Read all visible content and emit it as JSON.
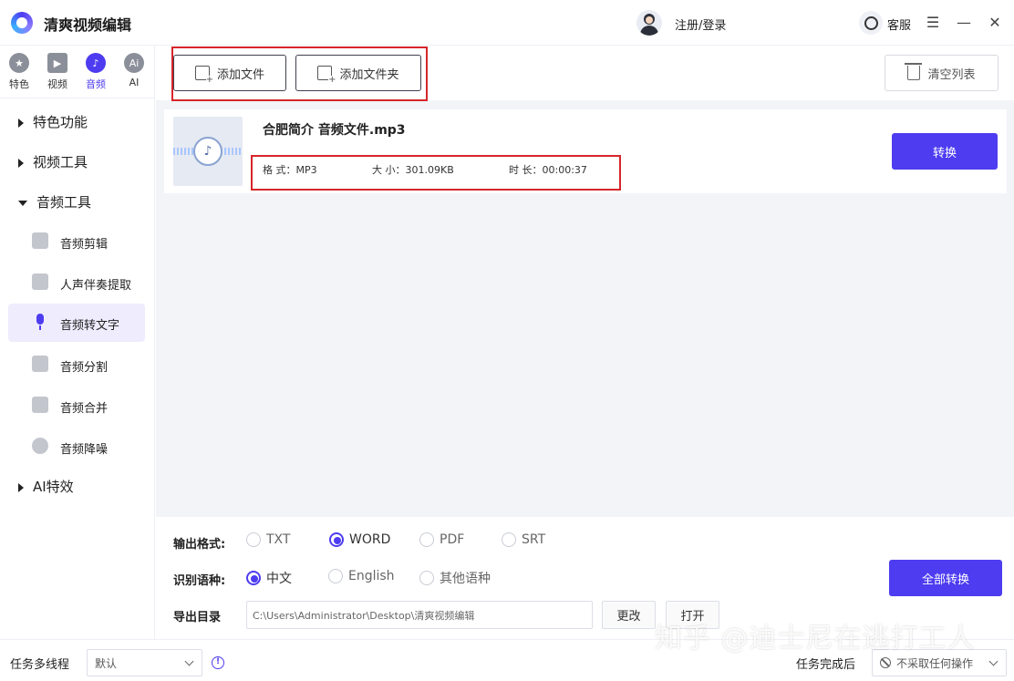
{
  "app": {
    "title": "清爽视频编辑",
    "login": "注册/登录",
    "service": "客服",
    "window_min": "—",
    "window_close": "✕",
    "window_menu": "☰"
  },
  "categories": [
    {
      "label": "特色",
      "glyph": "★"
    },
    {
      "label": "视频",
      "glyph": "▶"
    },
    {
      "label": "音频",
      "glyph": "♪"
    },
    {
      "label": "AI",
      "glyph": "Ai"
    }
  ],
  "sidebar": {
    "sections": [
      {
        "label": "特色功能"
      },
      {
        "label": "视频工具"
      },
      {
        "label": "音频工具"
      },
      {
        "label": "AI特效"
      }
    ],
    "items": [
      {
        "label": "音频剪辑"
      },
      {
        "label": "人声伴奏提取"
      },
      {
        "label": "音频转文字"
      },
      {
        "label": "音频分割"
      },
      {
        "label": "音频合并"
      },
      {
        "label": "音频降噪"
      }
    ]
  },
  "toolbar": {
    "add_file": "添加文件",
    "add_folder": "添加文件夹",
    "clear_list": "清空列表"
  },
  "file": {
    "name": "合肥简介 音频文件.mp3",
    "format": "格  式：MP3",
    "size": "大  小：301.09KB",
    "duration": "时  长：00:00:37",
    "convert": "转换"
  },
  "settings": {
    "output_format_label": "输出格式:",
    "formats": [
      "TXT",
      "WORD",
      "PDF",
      "SRT"
    ],
    "selected_format": "WORD",
    "language_label": "识别语种:",
    "languages": [
      "中文",
      "English",
      "其他语种"
    ],
    "selected_language": "中文",
    "export_label": "导出目录",
    "export_path": "C:\\Users\\Administrator\\Desktop\\清爽视频编辑",
    "change": "更改",
    "open": "打开",
    "convert_all": "全部转换"
  },
  "statusbar": {
    "threads_label": "任务多线程",
    "threads_value": "默认",
    "after_label": "任务完成后",
    "after_value": "不采取任何操作"
  },
  "watermark": "知乎 @迪士尼在逃打工人",
  "colors": {
    "accent": "#4d3cf0",
    "highlight_box": "#d6262b"
  }
}
